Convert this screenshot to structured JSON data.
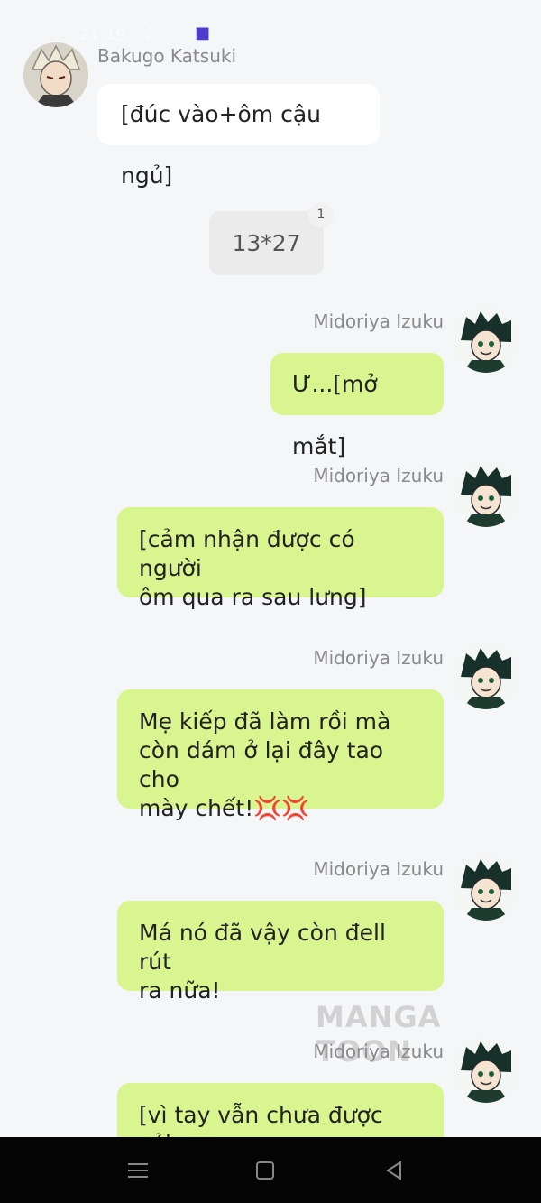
{
  "status_bar": {
    "time": "21:19",
    "battery": "..."
  },
  "colors": {
    "background": "#f5f6f8",
    "incoming_bubble": "#ffffff",
    "outgoing_bubble": "#d8f58f",
    "system_bubble": "#ebebeb"
  },
  "messages": [
    {
      "sender": "Bakugo Katsuki",
      "side": "left",
      "text": "[đúc vào+ôm cậu ngủ]"
    },
    {
      "side": "system",
      "text": "13*27",
      "badge": "1"
    },
    {
      "sender": "Midoriya Izuku",
      "side": "right",
      "text": "Ư...[mở mắt]"
    },
    {
      "sender": "Midoriya Izuku",
      "side": "right",
      "lines": [
        "[cảm nhận được có người",
        "ôm qua ra sau lưng]"
      ]
    },
    {
      "sender": "Midoriya Izuku",
      "side": "right",
      "lines": [
        "Mẹ kiếp đã làm rồi mà",
        "còn dám ở lại đây tao cho",
        "mày chết!💢💢"
      ]
    },
    {
      "sender": "Midoriya Izuku",
      "side": "right",
      "lines": [
        "Má nó đã vậy còn đell rút",
        "ra nữa!"
      ]
    },
    {
      "sender": "Midoriya Izuku",
      "side": "right",
      "lines": [
        "[vì tay vẫn chưa được cởi"
      ]
    }
  ],
  "watermark": "MANGA TOON",
  "nav": {
    "icons": [
      "menu-icon",
      "home-icon",
      "back-icon"
    ]
  }
}
